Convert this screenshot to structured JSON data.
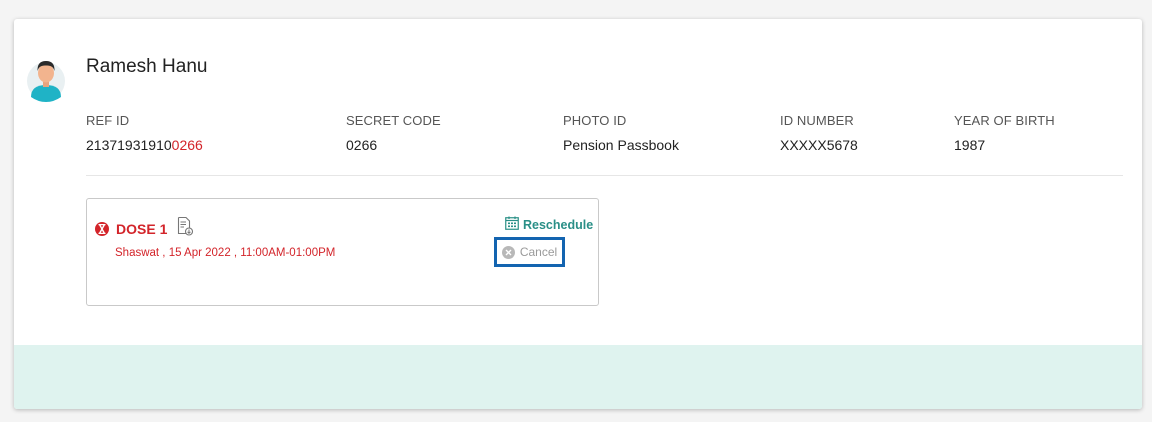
{
  "beneficiary": {
    "name": "Ramesh Hanu",
    "fields": [
      {
        "label": "REF ID",
        "value_prefix": "21371931910",
        "value_highlight": "0266"
      },
      {
        "label": "SECRET CODE",
        "value": "0266"
      },
      {
        "label": "PHOTO ID",
        "value": "Pension Passbook"
      },
      {
        "label": "ID NUMBER",
        "value": "XXXXX5678"
      },
      {
        "label": "YEAR OF BIRTH",
        "value": "1987"
      }
    ]
  },
  "dose": {
    "label": "DOSE 1",
    "details": "Shaswat , 15 Apr 2022 , 11:00AM-01:00PM",
    "reschedule_label": "Reschedule",
    "cancel_label": "Cancel"
  },
  "icons": {
    "avatar": "avatar",
    "status": "hourglass-icon",
    "certificate": "certificate-download-icon",
    "reschedule": "calendar-icon",
    "cancel": "close-circle-icon"
  },
  "colors": {
    "accent": "#2a8f87",
    "alert": "#d3242a",
    "footer_bg": "#dff3ef",
    "focus_border": "#1364b0"
  }
}
